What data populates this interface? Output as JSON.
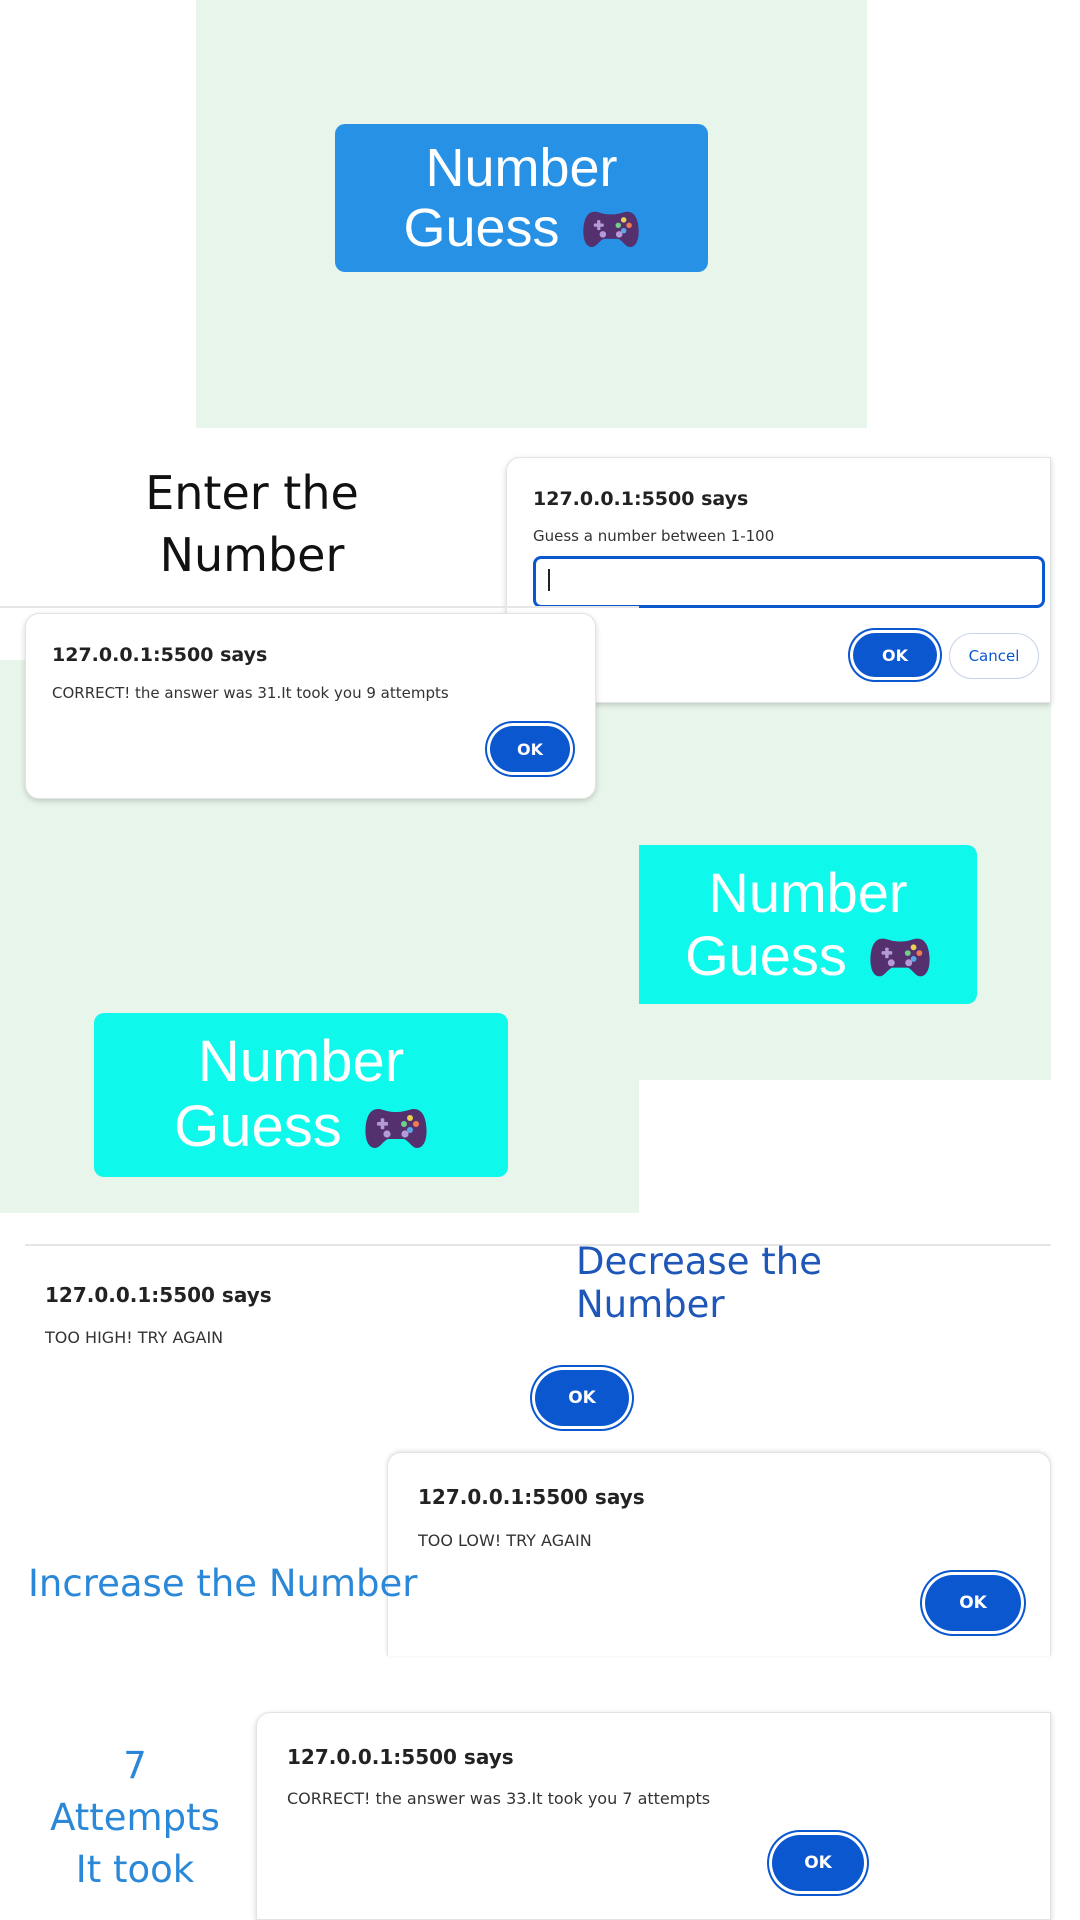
{
  "game": {
    "title_line1": "Number",
    "title_line2": "Guess",
    "icon": "gamepad-icon"
  },
  "captions": {
    "enter": "Enter the Number",
    "decrease": "Decrease the Number",
    "increase": "Increase the Number",
    "attempts_line1": "7",
    "attempts_line2": "Attempts",
    "attempts_line3": "It took"
  },
  "dialogs": {
    "prompt": {
      "origin": "127.0.0.1:5500 says",
      "message": "Guess a number between 1-100",
      "input_value": "",
      "ok_label": "OK",
      "cancel_label": "Cancel"
    },
    "correct_31": {
      "origin": "127.0.0.1:5500 says",
      "message": "CORRECT! the answer was 31.It took you 9 attempts",
      "ok_label": "OK"
    },
    "too_high": {
      "origin": "127.0.0.1:5500 says",
      "message": "TOO HIGH! TRY AGAIN",
      "ok_label": "OK"
    },
    "too_low": {
      "origin": "127.0.0.1:5500 says",
      "message": "TOO LOW! TRY AGAIN",
      "ok_label": "OK"
    },
    "correct_33": {
      "origin": "127.0.0.1:5500 says",
      "message": "CORRECT! the answer was 33.It took you 7 attempts",
      "ok_label": "OK"
    }
  },
  "colors": {
    "panel_green": "#e8f5ea",
    "title_blue": "#2791e6",
    "title_cyan": "#0ef9ec",
    "chrome_blue": "#0b57d0",
    "caption_blue": "#1e57b8",
    "caption_sky": "#2b88d8"
  }
}
